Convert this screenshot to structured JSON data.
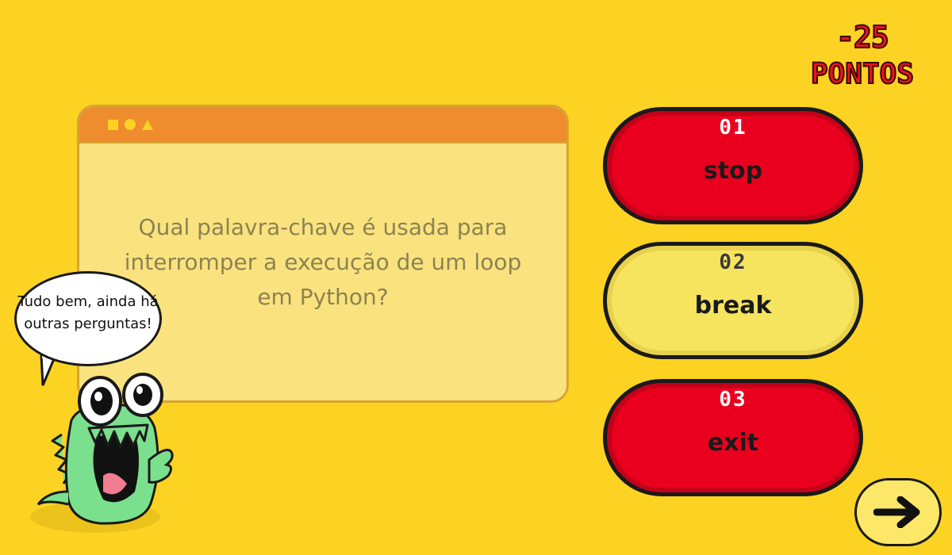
{
  "score": {
    "points": "-25",
    "label": "PONTOS"
  },
  "question": {
    "text": "Qual palavra-chave é usada para interromper a execução de um loop em Python?"
  },
  "answers": [
    {
      "number": "01",
      "text": "stop",
      "state": "wrong",
      "color": "#E9001E"
    },
    {
      "number": "02",
      "text": "break",
      "state": "correct",
      "color": "#F6E45F"
    },
    {
      "number": "03",
      "text": "exit",
      "state": "wrong",
      "color": "#E9001E"
    }
  ],
  "mascot": {
    "speech": "Tudo bem, ainda há outras perguntas!"
  },
  "colors": {
    "background": "#FDD323",
    "window_title": "#EF8C2E",
    "window_body": "#FAE37F"
  },
  "icons": {
    "next": "arrow-right-icon",
    "window_shapes": [
      "square-icon",
      "circle-icon",
      "triangle-icon"
    ]
  }
}
